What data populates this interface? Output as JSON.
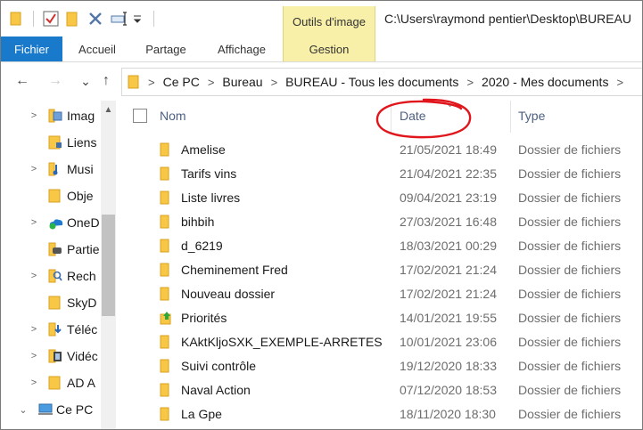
{
  "title": {
    "tool_tab": "Outils d'image",
    "path": "C:\\Users\\raymond pentier\\Desktop\\BUREAU"
  },
  "quick_access": [
    "folder-icon",
    "properties-check-icon",
    "new-folder-icon",
    "delete-x-icon",
    "rename-icon",
    "customize-dropdown-icon"
  ],
  "ribbon": {
    "tabs": [
      "Fichier",
      "Accueil",
      "Partage",
      "Affichage",
      "Gestion"
    ]
  },
  "nav": {
    "back": "←",
    "forward": "→",
    "recent": "⌄",
    "up": "↑",
    "breadcrumb": [
      "Ce PC",
      "Bureau",
      "BUREAU - Tous les documents",
      "2020 - Mes documents"
    ]
  },
  "sidebar": {
    "items": [
      {
        "label": "Imag",
        "icon": "pictures-icon",
        "chevron": true
      },
      {
        "label": "Liens",
        "icon": "links-icon",
        "chevron": false
      },
      {
        "label": "Musi",
        "icon": "music-icon",
        "chevron": true
      },
      {
        "label": "Obje",
        "icon": "objects-folder-icon",
        "chevron": false
      },
      {
        "label": "OneD",
        "icon": "onedrive-icon",
        "chevron": true
      },
      {
        "label": "Partie",
        "icon": "saved-games-icon",
        "chevron": false
      },
      {
        "label": "Rech",
        "icon": "searches-icon",
        "chevron": true
      },
      {
        "label": "SkyD",
        "icon": "folder-icon",
        "chevron": false
      },
      {
        "label": "Téléc",
        "icon": "downloads-icon",
        "chevron": true
      },
      {
        "label": "Vidéc",
        "icon": "videos-icon",
        "chevron": true
      },
      {
        "label": "AD A",
        "icon": "folder-icon",
        "chevron": true
      },
      {
        "label": "Ce PC",
        "icon": "computer-icon",
        "chevron": true,
        "expanded": true
      }
    ]
  },
  "columns": {
    "name": "Nom",
    "date": "Date",
    "type": "Type"
  },
  "files": [
    {
      "name": "Amelise",
      "date": "21/05/2021 18:49",
      "type": "Dossier de fichiers",
      "icon": "folder-icon"
    },
    {
      "name": "Tarifs vins",
      "date": "21/04/2021 22:35",
      "type": "Dossier de fichiers",
      "icon": "folder-icon"
    },
    {
      "name": "Liste livres",
      "date": "09/04/2021 23:19",
      "type": "Dossier de fichiers",
      "icon": "folder-icon"
    },
    {
      "name": "bihbih",
      "date": "27/03/2021 16:48",
      "type": "Dossier de fichiers",
      "icon": "folder-icon"
    },
    {
      "name": "d_6219",
      "date": "18/03/2021 00:29",
      "type": "Dossier de fichiers",
      "icon": "folder-icon"
    },
    {
      "name": "Cheminement Fred",
      "date": "17/02/2021 21:24",
      "type": "Dossier de fichiers",
      "icon": "folder-icon"
    },
    {
      "name": "Nouveau dossier",
      "date": "17/02/2021 21:24",
      "type": "Dossier de fichiers",
      "icon": "folder-icon"
    },
    {
      "name": "Priorités",
      "date": "14/01/2021 19:55",
      "type": "Dossier de fichiers",
      "icon": "folder-up-arrow-icon"
    },
    {
      "name": "KAktKljoSXK_EXEMPLE-ARRETES",
      "date": "10/01/2021 23:06",
      "type": "Dossier de fichiers",
      "icon": "folder-icon"
    },
    {
      "name": "Suivi contrôle",
      "date": "19/12/2020 18:33",
      "type": "Dossier de fichiers",
      "icon": "folder-icon"
    },
    {
      "name": "Naval Action",
      "date": "07/12/2020 18:53",
      "type": "Dossier de fichiers",
      "icon": "folder-icon"
    },
    {
      "name": "La Gpe",
      "date": "18/11/2020 18:30",
      "type": "Dossier de fichiers",
      "icon": "folder-icon"
    }
  ],
  "colors": {
    "file_tab": "#1979ca",
    "tool_tab": "#f8f0a8",
    "folder": "#f7c745",
    "header_text": "#4d6082",
    "annotation": "#e0161c"
  }
}
